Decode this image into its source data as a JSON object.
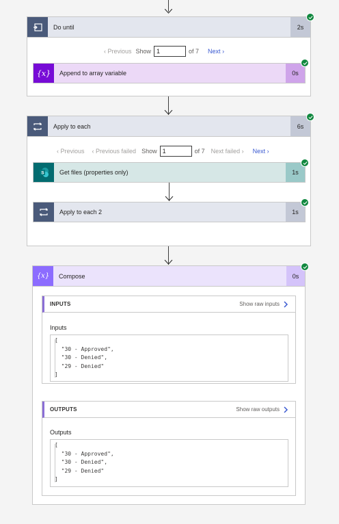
{
  "do_until": {
    "title": "Do until",
    "duration": "2s",
    "pager": {
      "previous": "Previous",
      "show": "Show",
      "value": "1",
      "of": "of 7",
      "next": "Next"
    },
    "child": {
      "title": "Append to array variable",
      "duration": "0s",
      "icon": "{x}"
    }
  },
  "apply_each": {
    "title": "Apply to each",
    "duration": "6s",
    "pager": {
      "previous": "Previous",
      "previous_failed": "Previous failed",
      "show": "Show",
      "value": "1",
      "of": "of 7",
      "next_failed": "Next failed",
      "next": "Next"
    },
    "children": [
      {
        "title": "Get files (properties only)",
        "duration": "1s",
        "icon": "sharepoint-icon"
      },
      {
        "title": "Apply to each 2",
        "duration": "1s",
        "icon": "loop-icon"
      }
    ]
  },
  "compose": {
    "title": "Compose",
    "duration": "0s",
    "icon": "{x}",
    "inputs": {
      "header": "INPUTS",
      "raw_link": "Show raw inputs",
      "label": "Inputs",
      "lines": [
        "[",
        "  \"30 - Approved\",",
        "  \"30 - Denied\",",
        "  \"29 - Denied\"",
        "]"
      ]
    },
    "outputs": {
      "header": "OUTPUTS",
      "raw_link": "Show raw outputs",
      "label": "Outputs",
      "lines": [
        "[",
        "  \"30 - Approved\",",
        "  \"30 - Denied\",",
        "  \"29 - Denied\"",
        "]"
      ]
    }
  },
  "colors": {
    "loop_header": "#4a5a7a",
    "variable": "#770bd6",
    "compose": "#8c6cff",
    "sharepoint": "#036c70",
    "success": "#11883f",
    "link": "#3a59d1"
  }
}
